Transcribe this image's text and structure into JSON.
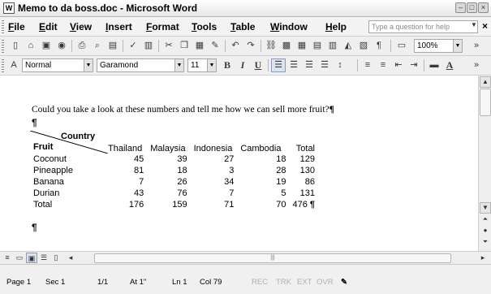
{
  "window": {
    "title": "Memo to da boss.doc - Microsoft Word",
    "icon_label": "W"
  },
  "menu": {
    "items": [
      "File",
      "Edit",
      "View",
      "Insert",
      "Format",
      "Tools",
      "Table",
      "Window",
      "Help"
    ],
    "help_placeholder": "Type a question for help"
  },
  "standard_toolbar": {
    "zoom": "100%"
  },
  "formatting_toolbar": {
    "style": "Normal",
    "font": "Garamond",
    "size": "11"
  },
  "document": {
    "sentence": "Could you take a look at these numbers and tell me how we can sell more fruit?",
    "table": {
      "column_header_label": "Country",
      "row_header_label": "Fruit",
      "columns": [
        "Thailand",
        "Malaysia",
        "Indonesia",
        "Cambodia",
        "Total"
      ],
      "rows": [
        {
          "label": "Coconut",
          "values": [
            "45",
            "39",
            "27",
            "18",
            "129"
          ]
        },
        {
          "label": "Pineapple",
          "values": [
            "81",
            "18",
            "3",
            "28",
            "130"
          ]
        },
        {
          "label": "Banana",
          "values": [
            "7",
            "26",
            "34",
            "19",
            "86"
          ]
        },
        {
          "label": "Durian",
          "values": [
            "43",
            "76",
            "7",
            "5",
            "131"
          ]
        },
        {
          "label": "Total",
          "values": [
            "176",
            "159",
            "71",
            "70",
            "476"
          ]
        }
      ]
    },
    "pilcrow": "¶"
  },
  "status": {
    "page": "Page 1",
    "section": "Sec 1",
    "page_count": "1/1",
    "at": "At 1\"",
    "line": "Ln 1",
    "col": "Col 79",
    "rec": "REC",
    "trk": "TRK",
    "ext": "EXT",
    "ovr": "OVR"
  }
}
